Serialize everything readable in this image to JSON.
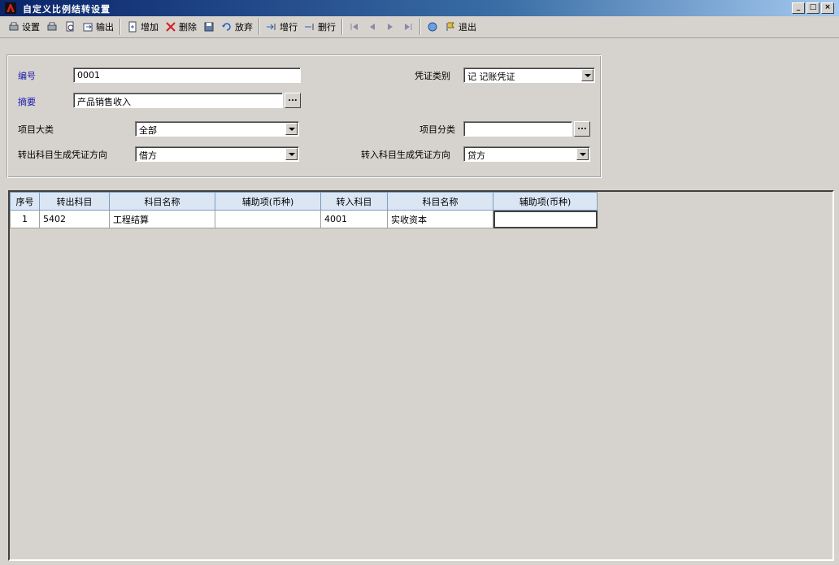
{
  "window": {
    "title": "自定义比例结转设置",
    "buttons": {
      "minimize": "_",
      "maximize": "□",
      "close": "×"
    }
  },
  "toolbar": {
    "setup": "设置",
    "export": "输出",
    "add": "增加",
    "delete": "删除",
    "discard": "放弃",
    "insert_row": "增行",
    "delete_row": "删行",
    "exit": "退出"
  },
  "form": {
    "code_label": "编号",
    "code_value": "0001",
    "summary_label": "摘要",
    "summary_value": "产品销售收入",
    "voucher_type_label": "凭证类别",
    "voucher_type_value": "记 记账凭证",
    "item_major_label": "项目大类",
    "item_major_value": "全部",
    "item_class_label": "项目分类",
    "item_class_value": "",
    "out_direction_label": "转出科目生成凭证方向",
    "out_direction_value": "借方",
    "in_direction_label": "转入科目生成凭证方向",
    "in_direction_value": "贷方",
    "browse": "..."
  },
  "grid": {
    "headers": [
      "序号",
      "转出科目",
      "科目名称",
      "辅助项(币种)",
      "转入科目",
      "科目名称",
      "辅助项(币种)"
    ],
    "rows": [
      [
        "1",
        "5402",
        "工程结算",
        "",
        "4001",
        "实收资本",
        ""
      ]
    ]
  },
  "colors": {
    "titlebar_start": "#0a246a",
    "titlebar_end": "#a6caf0",
    "background": "#d6d3ce",
    "header_bg": "#dbe6f5",
    "label_blue": "#2020b0"
  }
}
